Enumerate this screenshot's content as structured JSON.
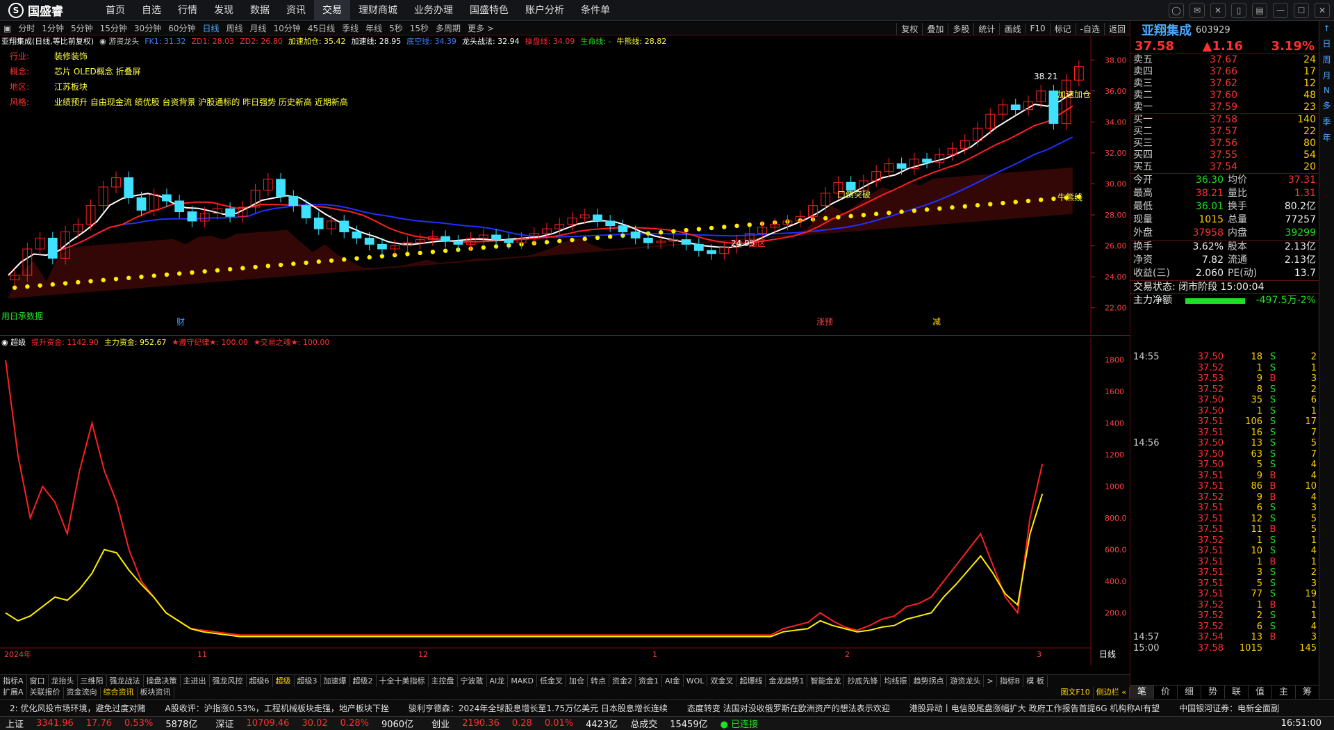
{
  "menu": {
    "brand": "国盛睿",
    "items": [
      "首页",
      "自选",
      "行情",
      "发现",
      "数据",
      "资讯",
      "交易",
      "理财商城",
      "业务办理",
      "国盛特色",
      "账户分析",
      "条件单"
    ],
    "active_index": 6
  },
  "period": {
    "items": [
      "分时",
      "1分钟",
      "5分钟",
      "15分钟",
      "30分钟",
      "60分钟",
      "日线",
      "周线",
      "月线",
      "10分钟",
      "45日线",
      "季线",
      "年线",
      "5秒",
      "15秒",
      "多周期",
      "更多 >"
    ],
    "active_index": 6,
    "tools": [
      "复权",
      "叠加",
      "多股",
      "统计",
      "画线",
      "F10",
      "标记",
      "-自选",
      "返回"
    ]
  },
  "main": {
    "header": {
      "stock": "亚翔集成(日线,等比前复权)",
      "ind": "游资龙头",
      "items": [
        {
          "t": "FK1: 31.32",
          "c": "#4080ff"
        },
        {
          "t": "ZD1: 28.03",
          "c": "#ff3030"
        },
        {
          "t": "ZD2: 26.80",
          "c": "#ff3030"
        },
        {
          "t": "加速加仓: 35.42",
          "c": "#ffff40"
        },
        {
          "t": "加速线: 28.95",
          "c": "#ffffff"
        },
        {
          "t": "底空线: 34.39",
          "c": "#4080ff"
        },
        {
          "t": "龙头战法: 32.94",
          "c": "#ffffff"
        },
        {
          "t": "操盘线: 34.09",
          "c": "#ff3030"
        },
        {
          "t": "生命线: -",
          "c": "#20e020"
        },
        {
          "t": "牛熊线: 28.82",
          "c": "#ffff40"
        }
      ]
    },
    "info": [
      {
        "k": "行业:",
        "v": "装修装饰"
      },
      {
        "k": "概念:",
        "v": "芯片 OLED概念 折叠屏"
      },
      {
        "k": "地区:",
        "v": "江苏板块"
      },
      {
        "k": "风格:",
        "v": "业绩预升 自由现金流 绩优股 台资背景 沪股通标的 昨日强势 历史新高 近期新高"
      }
    ],
    "axis": [
      "38.00",
      "36.00",
      "34.00",
      "32.00",
      "30.00",
      "28.00",
      "26.00",
      "24.00",
      "22.00"
    ],
    "labels": {
      "high": "38.21",
      "low": "24.95",
      "buy_zone": "强区",
      "break": "口倒突破",
      "accel": "加速加仓",
      "bull": "牛熊线",
      "cai": "财",
      "zhang": "涨预",
      "jian": "减",
      "bl": "用日承数据"
    }
  },
  "sub": {
    "header": {
      "name": "超级",
      "items": [
        {
          "t": "提升资金: 1142.90",
          "c": "#ff3030"
        },
        {
          "t": "主力资金: 952.67",
          "c": "#ffff40"
        },
        {
          "t": "★遵守纪律★: 100.00",
          "c": "#ff3030"
        },
        {
          "t": "★交易之魂★: 100.00",
          "c": "#ff3030"
        }
      ]
    },
    "axis": [
      "1800",
      "1600",
      "1400",
      "1200",
      "1000",
      "800.0",
      "600.0",
      "400.0",
      "200.0"
    ],
    "dates": [
      "2024年",
      "11",
      "12",
      "1",
      "2",
      "3"
    ],
    "period_label": "日线"
  },
  "chart_data": {
    "type": "candlestick",
    "title": "",
    "ylim": [
      21,
      39
    ],
    "closes": [
      24.1,
      25.8,
      26.5,
      25.2,
      26.9,
      27.4,
      28.6,
      29.8,
      30.4,
      29.1,
      28.3,
      29.3,
      28.9,
      28.2,
      27.6,
      28.1,
      28.4,
      27.9,
      28.5,
      29.6,
      30.3,
      29.2,
      28.6,
      27.8,
      27.1,
      27.6,
      26.9,
      26.5,
      26.1,
      25.8,
      26.0,
      26.2,
      26.4,
      26.6,
      26.3,
      26.1,
      26.5,
      26.7,
      26.4,
      26.2,
      26.5,
      26.8,
      27.1,
      27.4,
      27.8,
      28.0,
      27.6,
      27.3,
      26.9,
      26.5,
      26.2,
      26.3,
      26.4,
      26.1,
      25.7,
      25.5,
      25.9,
      26.3,
      26.8,
      27.2,
      27.4,
      27.6,
      27.9,
      28.6,
      29.4,
      30.1,
      29.6,
      30.2,
      30.8,
      31.3,
      31.0,
      31.6,
      31.4,
      31.9,
      32.3,
      32.8,
      33.6,
      34.5,
      35.1,
      34.8,
      35.3,
      36.0,
      33.9,
      36.7,
      37.58
    ],
    "sub_red": [
      1800,
      1200,
      800,
      1000,
      900,
      700,
      1100,
      1400,
      1100,
      900,
      600,
      400,
      300,
      200,
      150,
      100,
      90,
      80,
      70,
      60,
      60,
      60,
      60,
      60,
      60,
      60,
      60,
      60,
      60,
      60,
      60,
      60,
      60,
      60,
      60,
      60,
      60,
      60,
      60,
      60,
      60,
      60,
      60,
      60,
      60,
      60,
      60,
      60,
      60,
      60,
      60,
      60,
      60,
      60,
      60,
      60,
      60,
      60,
      60,
      60,
      60,
      60,
      60,
      100,
      120,
      140,
      200,
      150,
      110,
      90,
      120,
      160,
      180,
      240,
      260,
      300,
      400,
      500,
      600,
      700,
      500,
      300,
      200,
      800,
      1142.9
    ],
    "sub_yellow": [
      200,
      150,
      180,
      240,
      300,
      280,
      350,
      450,
      600,
      580,
      470,
      380,
      300,
      200,
      150,
      100,
      80,
      70,
      60,
      50,
      50,
      50,
      50,
      50,
      50,
      50,
      50,
      50,
      50,
      50,
      50,
      50,
      50,
      50,
      50,
      50,
      50,
      50,
      50,
      50,
      50,
      50,
      50,
      50,
      50,
      50,
      50,
      50,
      50,
      50,
      50,
      50,
      50,
      50,
      50,
      50,
      50,
      50,
      50,
      50,
      50,
      50,
      50,
      80,
      90,
      100,
      150,
      120,
      100,
      80,
      90,
      110,
      120,
      160,
      180,
      200,
      300,
      380,
      470,
      560,
      450,
      320,
      250,
      700,
      952.67
    ]
  },
  "tabs1": [
    "指标A",
    "窗口",
    "龙抬头",
    "三维阳",
    "强龙战法",
    "操盘决策",
    "主进出",
    "强龙风控",
    "超级6",
    "超级",
    "超级3",
    "加速爆",
    "超级2",
    "十全十美指标",
    "主控盘",
    "宁波敢",
    "AI龙",
    "MAKD",
    "低金叉",
    "加仓",
    "转点",
    "资金2",
    "资金1",
    "AI金",
    "WOL",
    "双金叉",
    "起爆线",
    "金龙趋势1",
    "智能金龙",
    "抄底先锋",
    "均线振",
    "趋势拐点",
    "游资龙头",
    ">",
    "指标B",
    "模 板"
  ],
  "tabs1_active": 9,
  "tabs2": [
    "扩展A",
    "关联报价",
    "资金流向",
    "综合资讯",
    "板块资讯"
  ],
  "tabs2_active": 3,
  "tabs2_right": [
    "图文F10",
    "侧边栏 «"
  ],
  "news": [
    "2: 优化风投市场环境，避免过度对赌",
    "A股收评：沪指涨0.53%，工程机械板块走强，地产板块下挫",
    "骏利亨德森：2024年全球股息增长至1.75万亿美元 日本股息增长连续",
    "态度转变 法国对没收俄罗斯在欧洲资产的想法表示欢迎",
    "港股异动丨电信股尾盘涨幅扩大 政府工作报告首提6G 机构称AI有望",
    "中国银河证券：电新全面副"
  ],
  "status": [
    {
      "k": "上证",
      "v": "3341.96",
      "c": "17.76",
      "p": "0.53%",
      "a": "5878亿"
    },
    {
      "k": "深证",
      "v": "10709.46",
      "c": "30.02",
      "p": "0.28%",
      "a": "9060亿"
    },
    {
      "k": "创业",
      "v": "2190.36",
      "c": "0.28",
      "p": "0.01%",
      "a": "4423亿"
    }
  ],
  "status_total": {
    "k": "总成交",
    "v": "15459亿"
  },
  "status_conn": "已连接",
  "status_time": "16:51:00",
  "quote": {
    "name": "亚翔集成",
    "code": "603929",
    "price": "37.58",
    "change": "▲1.16",
    "pct": "3.19%",
    "asks": [
      {
        "l": "卖五",
        "p": "37.67",
        "q": "24"
      },
      {
        "l": "卖四",
        "p": "37.66",
        "q": "17"
      },
      {
        "l": "卖三",
        "p": "37.62",
        "q": "12"
      },
      {
        "l": "卖二",
        "p": "37.60",
        "q": "48"
      },
      {
        "l": "卖一",
        "p": "37.59",
        "q": "23"
      }
    ],
    "bids": [
      {
        "l": "买一",
        "p": "37.58",
        "q": "140"
      },
      {
        "l": "买二",
        "p": "37.57",
        "q": "22"
      },
      {
        "l": "买三",
        "p": "37.56",
        "q": "80"
      },
      {
        "l": "买四",
        "p": "37.55",
        "q": "54"
      },
      {
        "l": "买五",
        "p": "37.54",
        "q": "20"
      }
    ],
    "stats1": [
      {
        "a": "今开",
        "b": "36.30",
        "bc": "green",
        "c": "均价",
        "d": "37.31",
        "dc": "red"
      },
      {
        "a": "最高",
        "b": "38.21",
        "bc": "red",
        "c": "量比",
        "d": "1.31",
        "dc": "red"
      },
      {
        "a": "最低",
        "b": "36.01",
        "bc": "green",
        "c": "换手",
        "d": "80.2亿",
        "dc": "white"
      },
      {
        "a": "现量",
        "b": "1015",
        "bc": "yellow",
        "c": "总量",
        "d": "77257",
        "dc": "white"
      },
      {
        "a": "外盘",
        "b": "37958",
        "bc": "red",
        "c": "内盘",
        "d": "39299",
        "dc": "green"
      }
    ],
    "stats2": [
      {
        "a": "换手",
        "b": "3.62%",
        "bc": "white",
        "c": "股本",
        "d": "2.13亿",
        "dc": "white"
      },
      {
        "a": "净资",
        "b": "7.82",
        "bc": "white",
        "c": "流通",
        "d": "2.13亿",
        "dc": "white"
      },
      {
        "a": "收益(三)",
        "b": "2.060",
        "bc": "white",
        "c": "PE(动)",
        "d": "13.7",
        "dc": "white"
      }
    ],
    "trade_status": "交易状态: 闭市阶段 15:00:04",
    "net_label": "主力净额",
    "net_value": "-497.5万",
    "net_pct": "-2%",
    "ticks": [
      {
        "t": "14:55",
        "p": "37.50",
        "v": "18",
        "f": "S",
        "n": "2"
      },
      {
        "t": "",
        "p": "37.52",
        "v": "1",
        "f": "S",
        "n": "1"
      },
      {
        "t": "",
        "p": "37.53",
        "v": "9",
        "f": "B",
        "n": "3"
      },
      {
        "t": "",
        "p": "37.52",
        "v": "8",
        "f": "S",
        "n": "2"
      },
      {
        "t": "",
        "p": "37.50",
        "v": "35",
        "f": "S",
        "n": "6"
      },
      {
        "t": "",
        "p": "37.50",
        "v": "1",
        "f": "S",
        "n": "1"
      },
      {
        "t": "",
        "p": "37.51",
        "v": "106",
        "f": "S",
        "n": "17"
      },
      {
        "t": "",
        "p": "37.51",
        "v": "16",
        "f": "S",
        "n": "7"
      },
      {
        "t": "14:56",
        "p": "37.50",
        "v": "13",
        "f": "S",
        "n": "5"
      },
      {
        "t": "",
        "p": "37.50",
        "v": "63",
        "f": "S",
        "n": "7"
      },
      {
        "t": "",
        "p": "37.50",
        "v": "5",
        "f": "S",
        "n": "4"
      },
      {
        "t": "",
        "p": "37.51",
        "v": "9",
        "f": "B",
        "n": "4"
      },
      {
        "t": "",
        "p": "37.51",
        "v": "86",
        "f": "B",
        "n": "10"
      },
      {
        "t": "",
        "p": "37.52",
        "v": "9",
        "f": "B",
        "n": "4"
      },
      {
        "t": "",
        "p": "37.51",
        "v": "6",
        "f": "S",
        "n": "3"
      },
      {
        "t": "",
        "p": "37.51",
        "v": "12",
        "f": "S",
        "n": "5"
      },
      {
        "t": "",
        "p": "37.51",
        "v": "11",
        "f": "B",
        "n": "5"
      },
      {
        "t": "",
        "p": "37.52",
        "v": "1",
        "f": "S",
        "n": "1"
      },
      {
        "t": "",
        "p": "37.51",
        "v": "10",
        "f": "S",
        "n": "4"
      },
      {
        "t": "",
        "p": "37.51",
        "v": "1",
        "f": "B",
        "n": "1"
      },
      {
        "t": "",
        "p": "37.51",
        "v": "3",
        "f": "S",
        "n": "2"
      },
      {
        "t": "",
        "p": "37.51",
        "v": "5",
        "f": "S",
        "n": "3"
      },
      {
        "t": "",
        "p": "37.51",
        "v": "77",
        "f": "S",
        "n": "19"
      },
      {
        "t": "",
        "p": "37.52",
        "v": "1",
        "f": "B",
        "n": "1"
      },
      {
        "t": "",
        "p": "37.52",
        "v": "2",
        "f": "S",
        "n": "1"
      },
      {
        "t": "",
        "p": "37.52",
        "v": "6",
        "f": "S",
        "n": "4"
      },
      {
        "t": "14:57",
        "p": "37.54",
        "v": "13",
        "f": "B",
        "n": "3"
      },
      {
        "t": "15:00",
        "p": "37.58",
        "v": "1015",
        "f": "",
        "n": "145"
      }
    ],
    "btabs": [
      "笔",
      "价",
      "细",
      "势",
      "联",
      "值",
      "主",
      "筹"
    ],
    "btabs_active": 0
  },
  "sidebar": [
    "↑",
    "日",
    "周",
    "月",
    "N",
    "多",
    "季",
    "年"
  ]
}
